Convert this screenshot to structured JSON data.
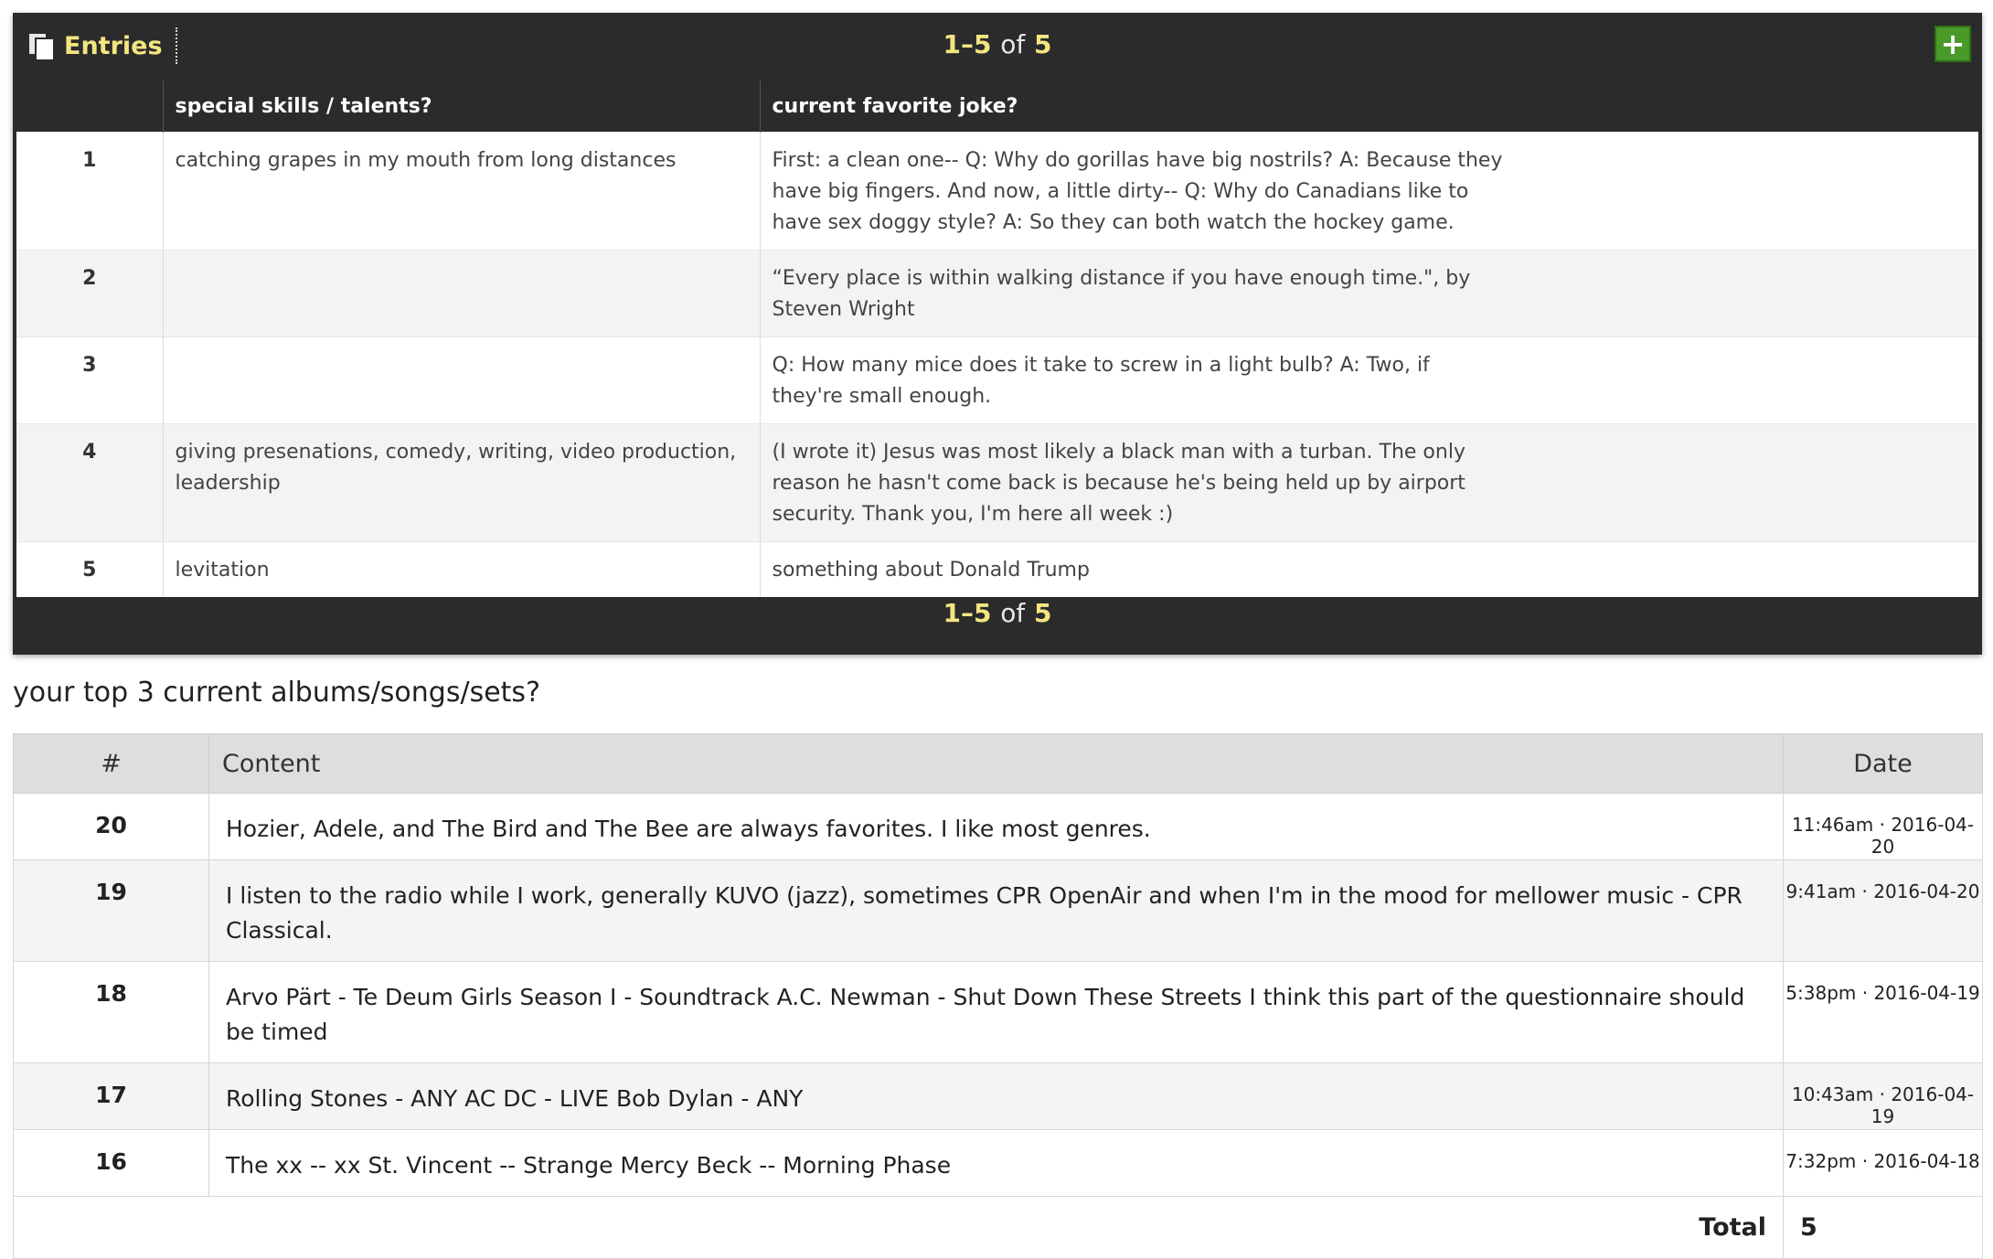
{
  "entries": {
    "title": "Entries",
    "pager": {
      "start": "1",
      "end": "5",
      "of": "of",
      "total": "5",
      "dash": "–"
    },
    "add_label": "+",
    "columns": [
      "",
      "special skills / talents?",
      "current favorite joke?"
    ],
    "rows": [
      {
        "num": "1",
        "skills": "catching grapes in my mouth from long distances",
        "joke": "First: a clean one-- Q: Why do gorillas have big nostrils? A: Because they have big fingers. And now, a little dirty-- Q: Why do Canadians like to have sex doggy style? A: So they can both watch the hockey game."
      },
      {
        "num": "2",
        "skills": "",
        "joke": "“Every place is within walking distance if you have enough time.\", by Steven Wright"
      },
      {
        "num": "3",
        "skills": "",
        "joke": "Q: How many mice does it take to screw in a light bulb? A: Two, if they're small enough."
      },
      {
        "num": "4",
        "skills": "giving presenations, comedy, writing, video production, leadership",
        "joke": "(I wrote it) Jesus was most likely a black man with a turban. The only reason he hasn't come back is because he's being held up by airport security. Thank you, I'm here all week :)"
      },
      {
        "num": "5",
        "skills": "levitation",
        "joke": "something about Donald Trump"
      }
    ]
  },
  "albums": {
    "question": "your top 3 current albums/songs/sets?",
    "columns": {
      "num": "#",
      "content": "Content",
      "date": "Date"
    },
    "rows": [
      {
        "num": "20",
        "content": "Hozier, Adele, and The Bird and The Bee are always favorites. I like most genres.",
        "date": "11:46am · 2016-04-20"
      },
      {
        "num": "19",
        "content": "I listen to the radio while I work, generally KUVO (jazz), sometimes CPR OpenAir and when I'm in the mood for mellower music - CPR Classical.",
        "date": "9:41am · 2016-04-20"
      },
      {
        "num": "18",
        "content": "Arvo Pärt - Te Deum Girls Season I - Soundtrack A.C. Newman - Shut Down These Streets I think this part of the questionnaire should be timed",
        "date": "5:38pm · 2016-04-19"
      },
      {
        "num": "17",
        "content": "Rolling Stones - ANY AC DC - LIVE Bob Dylan - ANY",
        "date": "10:43am · 2016-04-19"
      },
      {
        "num": "16",
        "content": "The xx -- xx St. Vincent -- Strange Mercy Beck -- Morning Phase",
        "date": "7:32pm · 2016-04-18"
      }
    ],
    "total_label": "Total",
    "total_value": "5"
  },
  "icons": {
    "entries": "documents-icon",
    "add": "plus-icon"
  },
  "colors": {
    "panel": "#2b2b2b",
    "accent_yellow": "#f3e680",
    "add_green": "#4a9a2a"
  }
}
